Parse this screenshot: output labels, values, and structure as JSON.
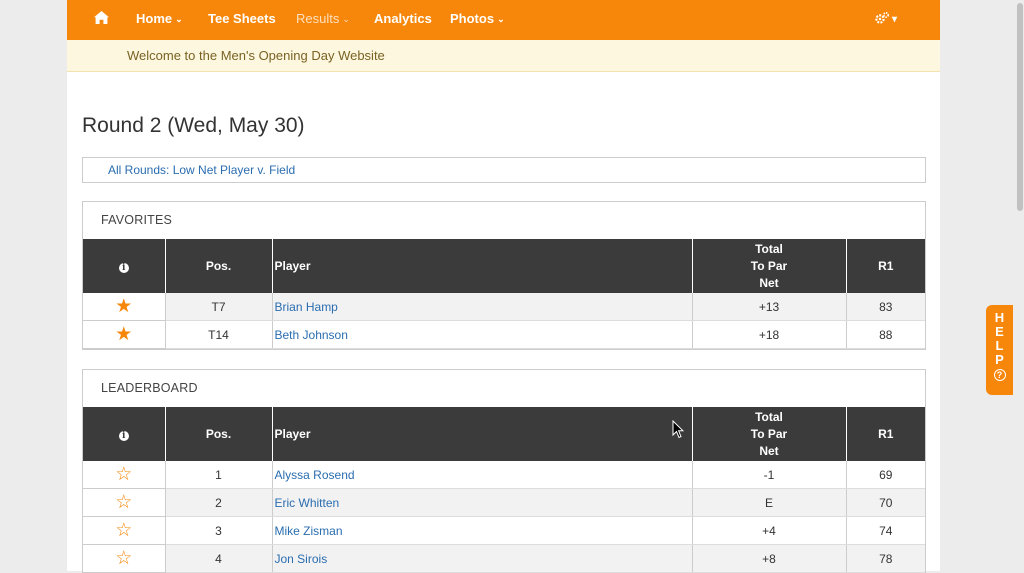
{
  "nav": {
    "home_icon": "home-icon",
    "items": [
      {
        "label": "Home",
        "has_caret": true
      },
      {
        "label": "Tee Sheets",
        "has_caret": false
      },
      {
        "label": "Results",
        "has_caret": true
      },
      {
        "label": "Analytics",
        "has_caret": false
      },
      {
        "label": "Photos",
        "has_caret": true
      }
    ],
    "caret": "⌄",
    "settings_icon": "gears-icon",
    "settings_caret": "▾"
  },
  "welcome": "Welcome to the Men's Opening Day Website",
  "page_title": "Round 2 (Wed, May 30)",
  "rounds_link": "All Rounds: Low Net Player v. Field",
  "table_headers": {
    "info": "i",
    "pos": "Pos.",
    "player": "Player",
    "total_1": "Total",
    "total_2": "To Par",
    "total_3": "Net",
    "r1": "R1"
  },
  "favorites": {
    "title": "FAVORITES",
    "rows": [
      {
        "starred": true,
        "pos": "T7",
        "player": "Brian Hamp",
        "to_par": "+13",
        "r1": "83"
      },
      {
        "starred": true,
        "pos": "T14",
        "player": "Beth Johnson",
        "to_par": "+18",
        "r1": "88"
      }
    ]
  },
  "leaderboard": {
    "title": "LEADERBOARD",
    "rows": [
      {
        "starred": false,
        "pos": "1",
        "player": "Alyssa Rosend",
        "to_par": "-1",
        "r1": "69"
      },
      {
        "starred": false,
        "pos": "2",
        "player": "Eric Whitten",
        "to_par": "E",
        "r1": "70"
      },
      {
        "starred": false,
        "pos": "3",
        "player": "Mike Zisman",
        "to_par": "+4",
        "r1": "74"
      },
      {
        "starred": false,
        "pos": "4",
        "player": "Jon Sirois",
        "to_par": "+8",
        "r1": "78"
      }
    ]
  },
  "help": {
    "letters": [
      "H",
      "E",
      "L",
      "P"
    ],
    "icon": "?"
  },
  "colors": {
    "accent": "#f7870a",
    "header": "#3b3b3b",
    "link": "#2a6db0"
  }
}
